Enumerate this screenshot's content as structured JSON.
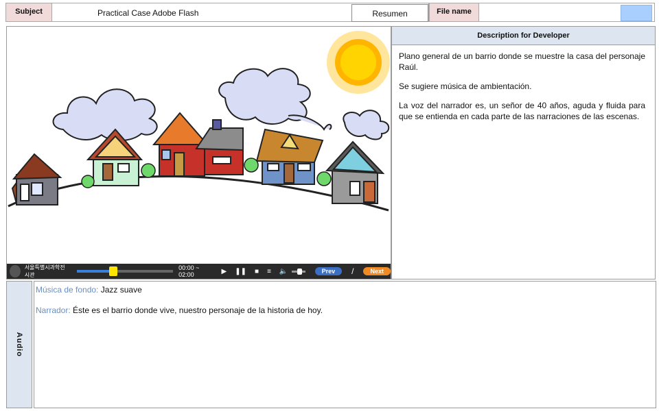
{
  "header": {
    "subject_label": "Subject",
    "subject_value": "Practical Case Adobe Flash",
    "resumen_label": "Resumen",
    "filename_label": "File name",
    "filename_value": ""
  },
  "developer": {
    "title": "Description for Developer",
    "paragraphs": [
      "Plano general de un barrio donde se muestre la casa del personaje Raúl.",
      "Se sugiere música de ambientación.",
      "La voz del narrador es, un señor de 40 años, aguda y fluida para que se entienda en cada parte de las narraciones de las escenas."
    ]
  },
  "player": {
    "logo_text": "서울특별시과학전시관",
    "time": "00:00 ~ 02:00",
    "progress": 0.38,
    "volume": 0.55,
    "prev_label": "Prev",
    "separator": "/",
    "next_label": "Next",
    "colors": {
      "prev": "#3a6fc4",
      "next": "#f08a24",
      "progress": "#ffe600"
    }
  },
  "audio": {
    "side_label": "Audio",
    "lines": [
      {
        "cue": "Música de fondo:",
        "text": "Jazz suave"
      },
      {
        "cue": "Narrador:",
        "text": "Éste es el barrio donde vive, nuestro personaje de la historia de hoy."
      }
    ]
  },
  "scene": {
    "description": "cartoon neighborhood with houses, clouds and sun"
  }
}
